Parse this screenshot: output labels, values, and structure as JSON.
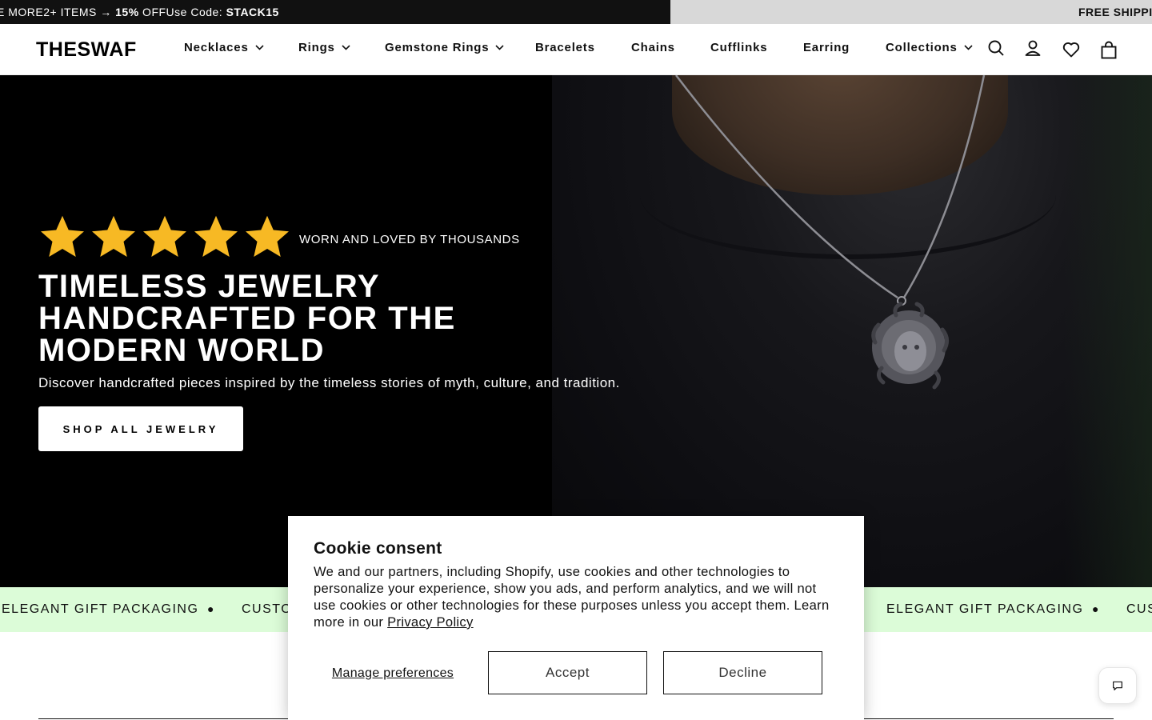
{
  "announcement": {
    "left_prefix": "E MORE2+ ITEMS → ",
    "left_discount": "15%",
    "left_mid": " OFFUse Code: ",
    "left_code": "STACK15",
    "right_text": "FREE SHIPPIN"
  },
  "header": {
    "logo": "THESWAF",
    "nav": [
      {
        "label": "Necklaces",
        "has_dropdown": true
      },
      {
        "label": "Rings",
        "has_dropdown": true
      },
      {
        "label": "Gemstone Rings",
        "has_dropdown": true
      },
      {
        "label": "Bracelets",
        "has_dropdown": false
      },
      {
        "label": "Chains",
        "has_dropdown": false
      },
      {
        "label": "Cufflinks",
        "has_dropdown": false
      },
      {
        "label": "Earring",
        "has_dropdown": false
      },
      {
        "label": "Collections",
        "has_dropdown": true
      }
    ],
    "icons": [
      "search-icon",
      "account-icon",
      "wishlist-heart-icon",
      "cart-bag-icon"
    ]
  },
  "hero": {
    "rating_stars": 5,
    "star_color": "#f7b924",
    "tagline": "WORN AND LOVED BY THOUSANDS",
    "title": "TIMELESS JEWELRY HANDCRAFTED FOR THE MODERN WORLD",
    "subtitle": "Discover handcrafted pieces inspired by the timeless stories of myth, culture, and tradition.",
    "cta": "SHOP ALL JEWELRY"
  },
  "marquee": {
    "background": "#dcfcd8",
    "items": [
      "ELEGANT GIFT PACKAGING",
      "CUSTO",
      "ELEGANT GIFT PACKAGING",
      "CUS"
    ]
  },
  "cookie": {
    "title": "Cookie consent",
    "body": "We and our partners, including Shopify, use cookies and other technologies to personalize your experience, show you ads, and perform analytics, and we will not use cookies or other technologies for these purposes unless you accept them. Learn more in our ",
    "privacy_link": "Privacy Policy",
    "manage": "Manage preferences",
    "accept": "Accept",
    "decline": "Decline"
  }
}
